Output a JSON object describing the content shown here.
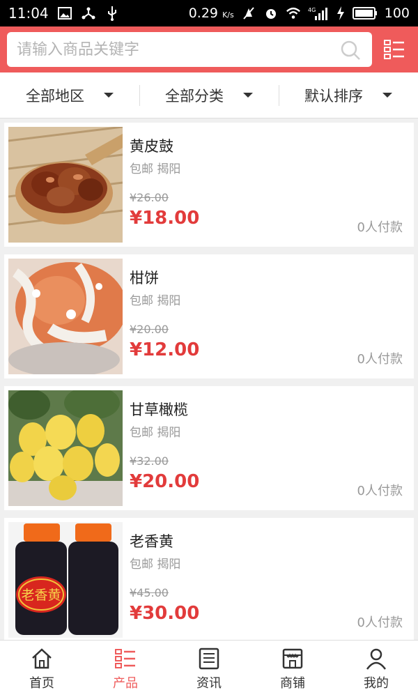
{
  "status_bar": {
    "time": "11:04",
    "speed": "0.29",
    "speed_unit": "K/s",
    "network": "4G",
    "battery": "100"
  },
  "search": {
    "placeholder": "请输入商品关键字"
  },
  "filters": [
    {
      "label": "全部地区"
    },
    {
      "label": "全部分类"
    },
    {
      "label": "默认排序"
    }
  ],
  "products": [
    {
      "name": "黄皮鼓",
      "tag": "包邮 揭阳",
      "old_price": "¥26.00",
      "price": "¥18.00",
      "paid": "0人付款"
    },
    {
      "name": "柑饼",
      "tag": "包邮 揭阳",
      "old_price": "¥20.00",
      "price": "¥12.00",
      "paid": "0人付款"
    },
    {
      "name": "甘草橄榄",
      "tag": "包邮 揭阳",
      "old_price": "¥32.00",
      "price": "¥20.00",
      "paid": "0人付款"
    },
    {
      "name": "老香黄",
      "tag": "包邮 揭阳",
      "old_price": "¥45.00",
      "price": "¥30.00",
      "paid": "0人付款"
    }
  ],
  "jar_label": "老香黄",
  "tabs": [
    {
      "label": "首页",
      "icon": "home-icon",
      "active": false
    },
    {
      "label": "产品",
      "icon": "list-icon",
      "active": true
    },
    {
      "label": "资讯",
      "icon": "news-icon",
      "active": false
    },
    {
      "label": "商铺",
      "icon": "shop-icon",
      "active": false
    },
    {
      "label": "我的",
      "icon": "user-icon",
      "active": false
    }
  ],
  "colors": {
    "brand": "#ef5b5b",
    "price": "#e23b3b"
  }
}
